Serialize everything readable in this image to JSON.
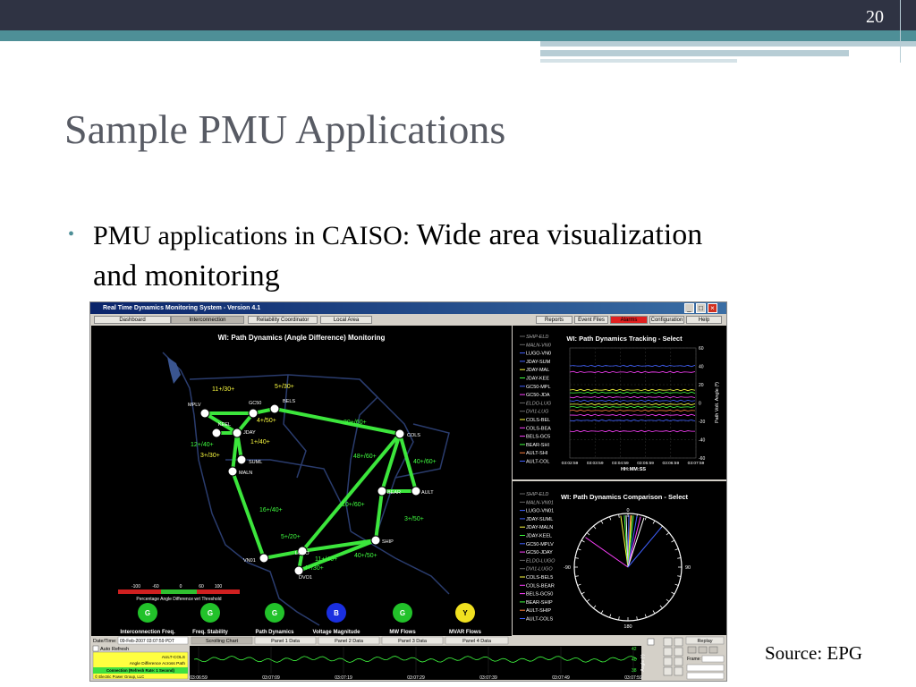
{
  "slide": {
    "page_number": "20",
    "title": "Sample PMU Applications",
    "bullet_lead": "PMU applications in CAISO: ",
    "bullet_rest": "Wide area visualization and monitoring",
    "source": "Source: EPG"
  },
  "app": {
    "window_title": "Real Time Dynamics Monitoring System - Version 4.1",
    "tabs": [
      "Dashboard",
      "Interconnection",
      "Reliability Coordinator",
      "Local Area"
    ],
    "right_tabs": [
      "Reports",
      "Event Files",
      "Alarms",
      "Configuration",
      "Help"
    ],
    "map_title": "WI: Path Dynamics (Angle Difference) Monitoring",
    "nodes": [
      "MPLV",
      "GC50",
      "BELS",
      "KEEL",
      "JDAY",
      "SUML",
      "MALN",
      "COLS",
      "BEAR",
      "AULT",
      "SHIP",
      "LUGO",
      "VN01",
      "DVO1"
    ],
    "edge_labels": [
      "11+/30+",
      "5+/30+",
      "4+/50+",
      "1+/40+",
      "12+/40+",
      "3+/30+",
      "30+/60+",
      "48+/60+",
      "40+/60+",
      "10+/60+",
      "3+/50+",
      "16+/40+",
      "5+/20+",
      "11+/40+",
      "40+/50+",
      "4+/30+"
    ],
    "scale_ticks": [
      "-100",
      "-60",
      "0",
      "60",
      "100"
    ],
    "scale_label": "Percentage Angle Difference wrt Threshold",
    "indicators": [
      {
        "letter": "G",
        "label": "Interconnection Freq.",
        "color": "#22c22a"
      },
      {
        "letter": "G",
        "label": "Freq. Stability",
        "color": "#22c22a"
      },
      {
        "letter": "G",
        "label": "Path Dynamics",
        "color": "#22c22a"
      },
      {
        "letter": "B",
        "label": "Voltage Magnitude",
        "color": "#1a2fe0"
      },
      {
        "letter": "G",
        "label": "MW Flows",
        "color": "#22c22a"
      },
      {
        "letter": "Y",
        "label": "MVAR Flows",
        "color": "#f0e020"
      }
    ],
    "tracking": {
      "title": "WI: Path Dynamics Tracking - Select",
      "legend": [
        "SHIP-ELD",
        "MALN-VN0",
        "LUGO-VN0",
        "JDAY-SUM",
        "JDAY-MAL",
        "JDAY-KEE",
        "GC50-MPL",
        "GC50-JDA",
        "ELDO-LUG",
        "DVI1-LUG",
        "COLS-BEL",
        "COLS-BEA",
        "BELS-GC5",
        "BEAR-SHI",
        "AULT-SHI",
        "AULT-COL"
      ],
      "yticks": [
        "60",
        "40",
        "20",
        "0",
        "-20",
        "-40",
        "-60"
      ],
      "xticks": [
        "03:02:59",
        "03:03:59",
        "03:04:59",
        "03:05:59",
        "03:06:59",
        "03:07:59"
      ],
      "xlabel": "HH:MM:SS",
      "ylabel": "Path Volt. Angle (º)"
    },
    "comparison": {
      "title": "WI: Path Dynamics Comparison - Select",
      "legend": [
        "SHIP-ELD",
        "MALN-VN01",
        "LUGO-VN01",
        "JDAY-SUML",
        "JDAY-MALN",
        "JDAY-KEEL",
        "GC50-MPLV",
        "GC50-JDAY",
        "ELDO-LUGO",
        "DVI1-LUGO",
        "COLS-BEL5",
        "COLS-BEAR",
        "BELS-GC50",
        "BEAR-SHIP",
        "AULT-SHIP",
        "AULT-COLS"
      ],
      "dial": [
        "0",
        "90",
        "180",
        "-90"
      ]
    },
    "bottom": {
      "datetime_label": "Date/Time:",
      "datetime": "09-Feb-2007 03:07:59 PDT",
      "auto_refresh": "Auto Refresh",
      "tabs": [
        "Scrolling Chart",
        "Panel 1 Data",
        "Panel 2 Data",
        "Panel 3 Data",
        "Panel 4 Data"
      ],
      "replay": "Replay",
      "frame_label": "Frame:",
      "info1": "AULT-COLS",
      "info2": "Angle Difference Across Path",
      "info3": "Connection (Refresh Rate: 1 Second)",
      "footer": "© Electric Power Group, LLC",
      "times": [
        "03:06:59",
        "03:07:09",
        "03:07:19",
        "03:07:29",
        "03:07:39",
        "03:07:49",
        "03:07:59"
      ],
      "yticks": [
        "42",
        "40",
        "38"
      ],
      "ylabel": "Angle (º)"
    }
  }
}
